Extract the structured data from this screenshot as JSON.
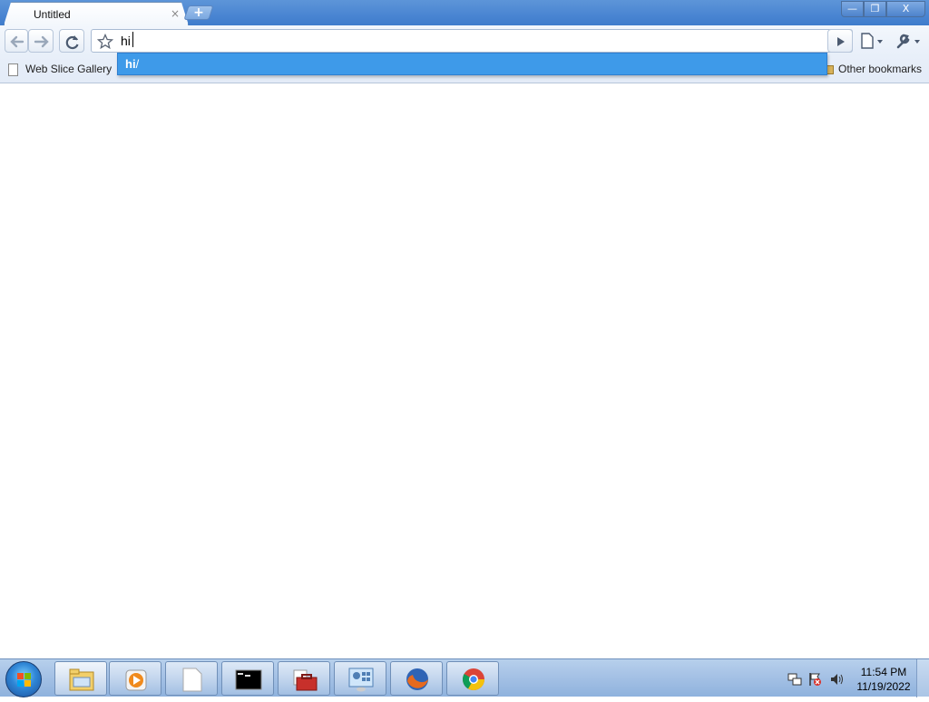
{
  "window": {
    "tab_title": "Untitled",
    "tab_close": "×",
    "new_tab": "+",
    "controls": {
      "minimize": "—",
      "maximize": "❐",
      "close": "X"
    }
  },
  "toolbar": {
    "back_icon": "arrow-left-icon",
    "forward_icon": "arrow-right-icon",
    "reload_icon": "reload-icon",
    "star_icon": "star-icon",
    "go_icon": "play-icon",
    "page_menu_icon": "page-icon",
    "wrench_icon": "wrench-icon"
  },
  "omnibox": {
    "value": "hi",
    "suggestion_bold": "hi",
    "suggestion_rest": "/"
  },
  "bookmarks": {
    "items": [
      {
        "label": "Web Slice Gallery"
      }
    ],
    "other": "Other bookmarks"
  },
  "taskbar": {
    "apps": [
      "file-explorer",
      "media-player",
      "notepad",
      "command-prompt",
      "toolbox",
      "control-panel",
      "firefox",
      "chrome"
    ],
    "clock": {
      "time": "11:54 PM",
      "date": "11/19/2022"
    }
  },
  "colors": {
    "titlebar": "#4a85d2",
    "suggestion_highlight": "#3e9ae9",
    "taskbar": "#a7c3e6"
  }
}
